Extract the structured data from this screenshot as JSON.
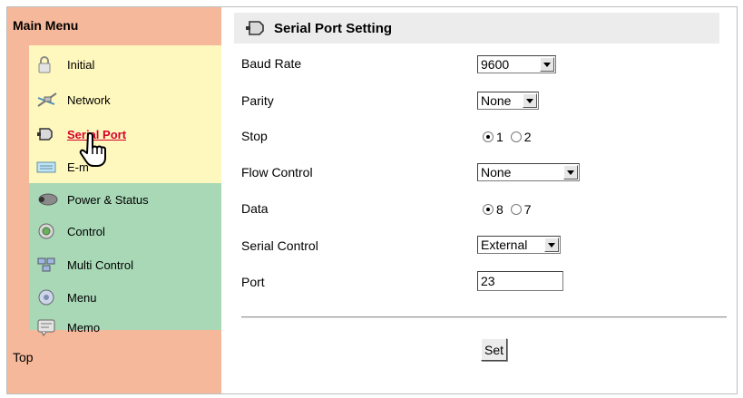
{
  "sidebar": {
    "title": "Main Menu",
    "items": [
      {
        "label": "Initial",
        "icon": "padlock-icon"
      },
      {
        "label": "Network",
        "icon": "network-icon"
      },
      {
        "label": "Serial Port",
        "icon": "serial-port-icon"
      },
      {
        "label": "E-m",
        "icon": "email-icon"
      },
      {
        "label": "Power & Status",
        "icon": "power-icon"
      },
      {
        "label": "Control",
        "icon": "control-icon"
      },
      {
        "label": "Multi Control",
        "icon": "multi-control-icon"
      },
      {
        "label": "Menu",
        "icon": "menu-icon"
      },
      {
        "label": "Memo",
        "icon": "memo-icon"
      }
    ],
    "active_item": "Serial Port",
    "top_link": "Top"
  },
  "main": {
    "title": "Serial Port Setting",
    "fields": {
      "baud_rate": {
        "label": "Baud Rate",
        "value": "9600"
      },
      "parity": {
        "label": "Parity",
        "value": "None"
      },
      "stop": {
        "label": "Stop",
        "options": [
          "1",
          "2"
        ],
        "selected": "1"
      },
      "flow_control": {
        "label": "Flow Control",
        "value": "None"
      },
      "data": {
        "label": "Data",
        "options": [
          "8",
          "7"
        ],
        "selected": "8"
      },
      "serial_control": {
        "label": "Serial Control",
        "value": "External"
      },
      "port": {
        "label": "Port",
        "value": "23"
      }
    },
    "set_button": "Set"
  },
  "colors": {
    "sidebar_bg": "#f6b89b",
    "group_yellow": "#fff8be",
    "group_green": "#a8d8b6",
    "active_link": "#d4002a"
  }
}
